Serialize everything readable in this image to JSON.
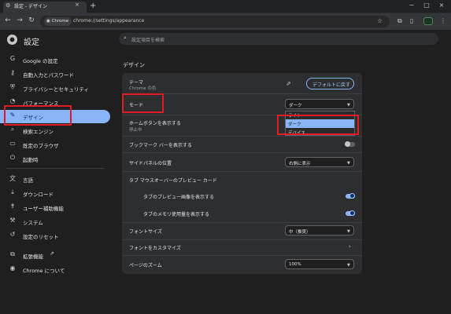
{
  "browser": {
    "tab_title": "設定 - デザイン",
    "new_tab_symbol": "+",
    "tab_close_symbol": "×",
    "chip_label": "Chrome",
    "url": "chrome://settings/appearance",
    "window_controls": {
      "minimize": "−",
      "maximize": "□",
      "close": "×"
    }
  },
  "sidebar": {
    "title": "設定",
    "items": [
      {
        "label": "Google の設定",
        "icon": "google-icon"
      },
      {
        "label": "自動入力とパスワード",
        "icon": "key-icon"
      },
      {
        "label": "プライバシーとセキュリティ",
        "icon": "shield-icon"
      },
      {
        "label": "パフォーマンス",
        "icon": "speedometer-icon"
      },
      {
        "label": "デザイン",
        "icon": "palette-icon",
        "active": true
      },
      {
        "label": "検索エンジン",
        "icon": "search-icon"
      },
      {
        "label": "既定のブラウザ",
        "icon": "browser-icon"
      },
      {
        "label": "起動時",
        "icon": "power-icon"
      },
      {
        "label": "言語",
        "icon": "translate-icon"
      },
      {
        "label": "ダウンロード",
        "icon": "download-icon"
      },
      {
        "label": "ユーザー補助機能",
        "icon": "accessibility-icon"
      },
      {
        "label": "システム",
        "icon": "wrench-icon"
      },
      {
        "label": "設定のリセット",
        "icon": "reset-icon"
      },
      {
        "label": "拡張機能",
        "icon": "extension-icon"
      },
      {
        "label": "Chrome について",
        "icon": "chrome-icon"
      }
    ]
  },
  "search": {
    "placeholder": "設定項目を検索"
  },
  "main": {
    "section_title": "デザイン",
    "theme": {
      "label": "テーマ",
      "sub": "Chrome の色",
      "reset_button": "デフォルトに戻す"
    },
    "mode": {
      "label": "モード",
      "value": "ダーク",
      "options": [
        "ライト",
        "ダーク",
        "デバイス"
      ],
      "highlighted": "ダーク"
    },
    "home_button": {
      "label": "ホームボタンを表示する",
      "sub": "停止中"
    },
    "bookmarks_bar": {
      "label": "ブックマーク バーを表示する",
      "enabled": false
    },
    "side_panel": {
      "label": "サイドパネルの位置",
      "value": "右側に表示"
    },
    "tab_hover": {
      "label": "タブ マウスオーバーのプレビュー カード"
    },
    "tab_preview": {
      "label": "タブのプレビュー画像を表示する",
      "enabled": true
    },
    "tab_memory": {
      "label": "タブのメモリ使用量を表示する",
      "enabled": true
    },
    "font_size": {
      "label": "フォントサイズ",
      "value": "中（推奨）"
    },
    "customize_fonts": {
      "label": "フォントをカスタマイズ"
    },
    "page_zoom": {
      "label": "ページのズーム",
      "value": "100%"
    }
  },
  "colors": {
    "accent": "#8ab4f8",
    "highlight_box": "#e21b24",
    "background": "#1f1f1f",
    "card": "#2d2e30"
  }
}
